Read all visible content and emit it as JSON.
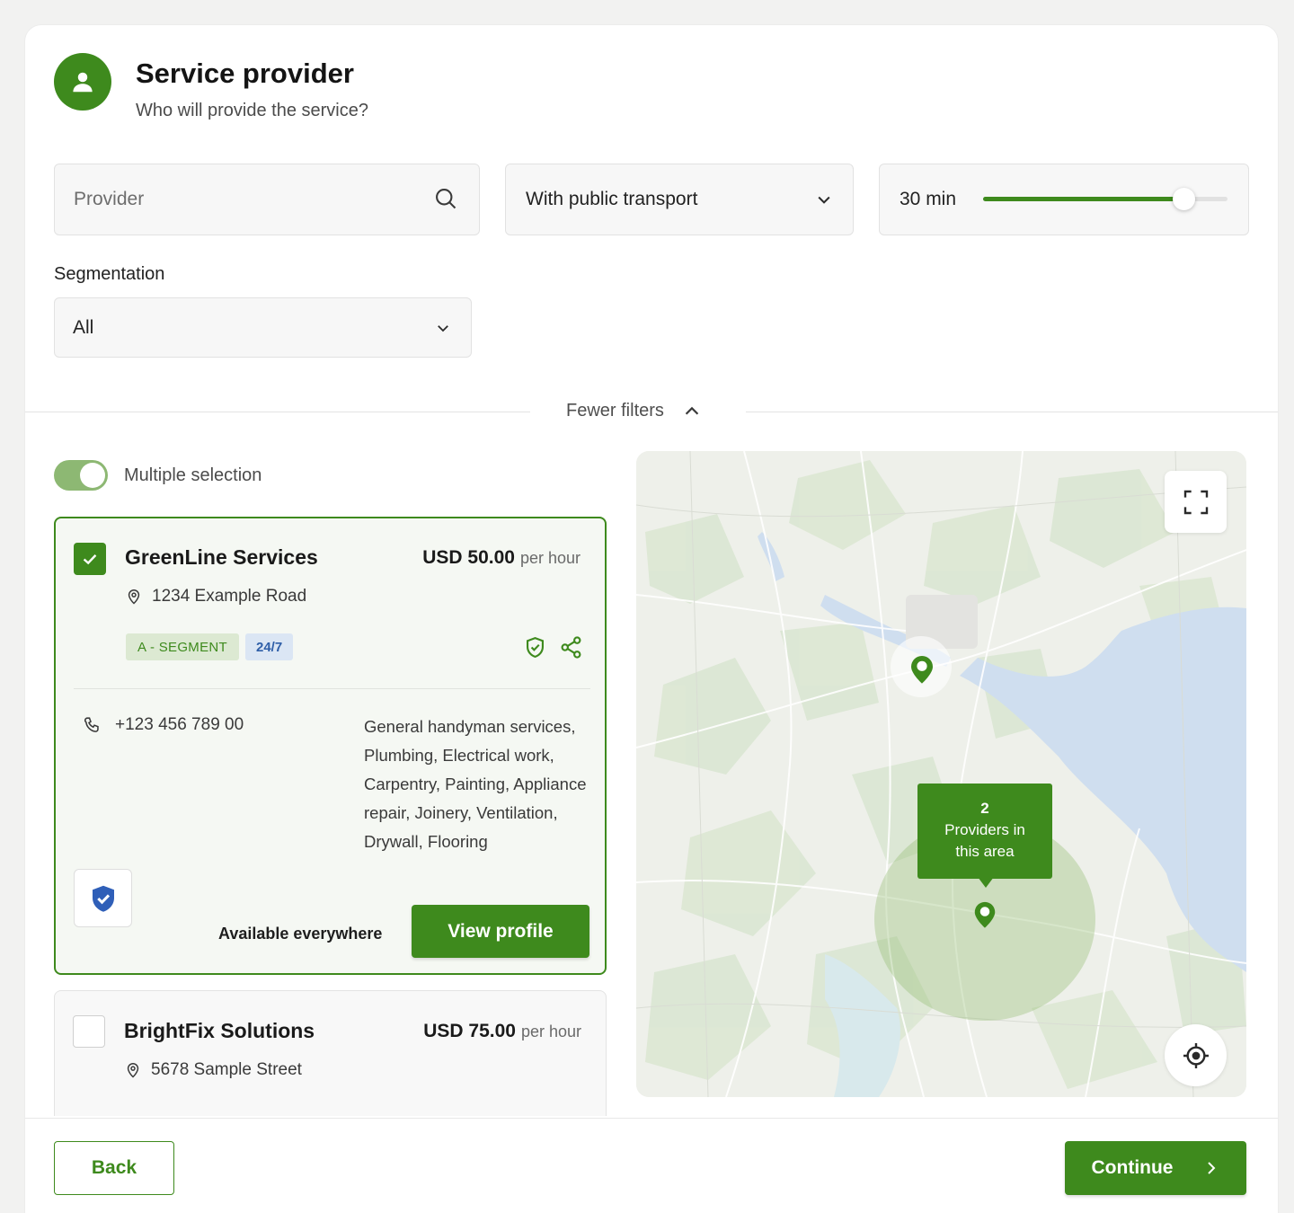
{
  "header": {
    "title": "Service provider",
    "subtitle": "Who will provide the service?"
  },
  "filters": {
    "provider_placeholder": "Provider",
    "transport_value": "With public transport",
    "time_value": "30 min",
    "time_slider_fraction": 0.82,
    "segmentation_label": "Segmentation",
    "segmentation_value": "All",
    "fewer_filters_label": "Fewer filters"
  },
  "multiple_selection": {
    "label": "Multiple selection",
    "enabled": true
  },
  "providers": [
    {
      "name": "GreenLine Services",
      "price": "USD 50.00",
      "price_unit": "per hour",
      "address": "1234 Example Road",
      "segment_badge": "A - SEGMENT",
      "hours_badge": "24/7",
      "phone": "+123 456 789 00",
      "services": "General handyman services, Plumbing, Electrical work, Carpentry, Painting, Appliance repair, Joinery, Ventilation, Drywall, Flooring",
      "availability": "Available everywhere",
      "view_profile_label": "View profile",
      "selected": true
    },
    {
      "name": "BrightFix Solutions",
      "price": "USD 75.00",
      "price_unit": "per hour",
      "address": "5678 Sample Street",
      "selected": false
    }
  ],
  "map": {
    "cluster_count": "2",
    "cluster_label": "Providers in this area"
  },
  "footer": {
    "back_label": "Back",
    "continue_label": "Continue"
  },
  "colors": {
    "accent": "#3e8a1d",
    "badge_blue": "#2f5fa8"
  }
}
